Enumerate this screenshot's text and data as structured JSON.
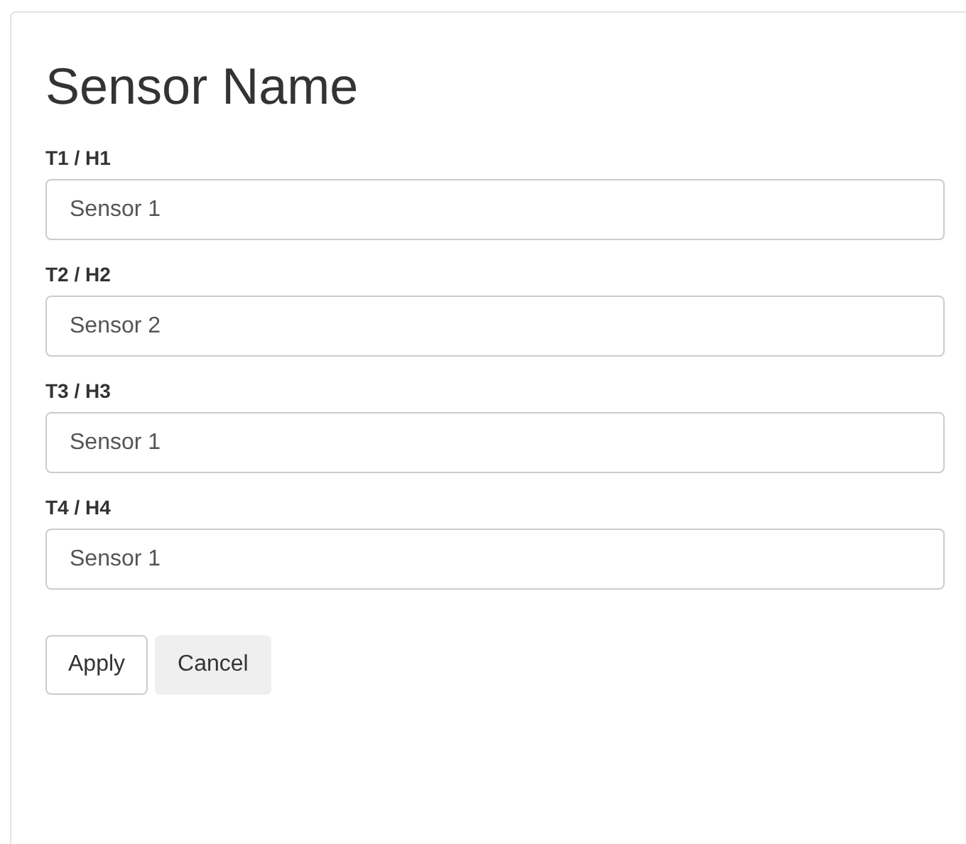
{
  "title": "Sensor Name",
  "fields": [
    {
      "label": "T1 / H1",
      "value": "Sensor 1"
    },
    {
      "label": "T2 / H2",
      "value": "Sensor 2"
    },
    {
      "label": "T3 / H3",
      "value": "Sensor 1"
    },
    {
      "label": "T4 / H4",
      "value": "Sensor 1"
    }
  ],
  "buttons": [
    {
      "label": "Apply",
      "kind": "default"
    },
    {
      "label": "Cancel",
      "kind": "secondary"
    }
  ]
}
